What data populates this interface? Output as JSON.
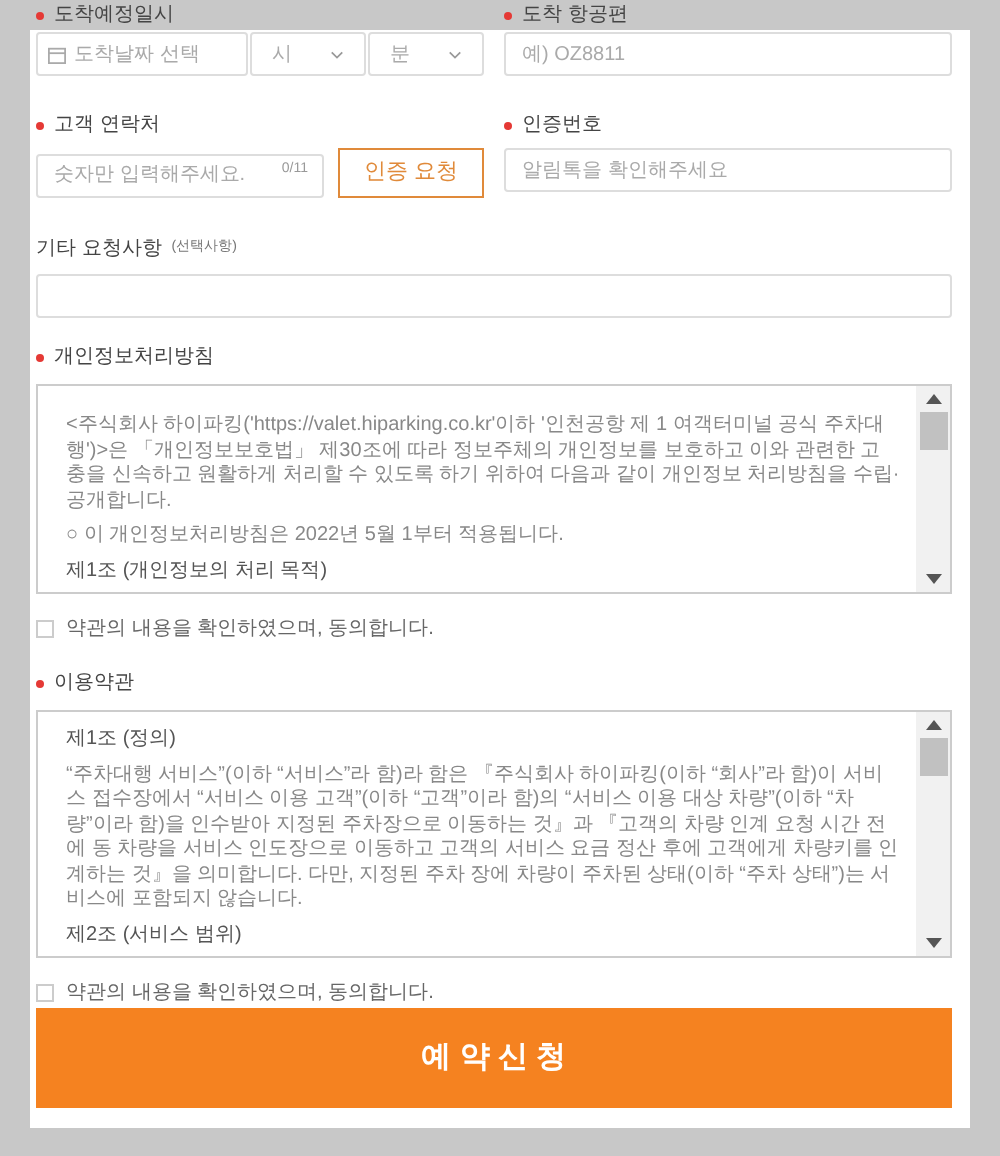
{
  "arrival": {
    "label": "도착예정일시",
    "required": true,
    "date_placeholder": "도착날짜 선택",
    "hour_placeholder": "시",
    "minute_placeholder": "분"
  },
  "flight": {
    "label": "도착 항공편",
    "required": true,
    "placeholder": "예) OZ8811"
  },
  "phone": {
    "label": "고객 연락처",
    "required": true,
    "placeholder": "숫자만 입력해주세요.",
    "counter": "0/11",
    "button": "인증 요청"
  },
  "auth_code": {
    "label": "인증번호",
    "required": true,
    "placeholder": "알림톡을 확인해주세요"
  },
  "request": {
    "label": "기타 요청사항",
    "note": "(선택사항)"
  },
  "privacy": {
    "label": "개인정보처리방침",
    "required": true,
    "blocks": [
      {
        "kind": "text",
        "text": "<주식회사 하이파킹('https://valet.hiparking.co.kr'이하 '인천공항 제 1 여객터미널 공식 주차대행')>은 「개인정보보호법」 제30조에 따라 정보주체의 개인정보를 보호하고 이와 관련한 고충을 신속하고 원활하게 처리할 수 있도록 하기 위하여 다음과 같이 개인정보 처리방침을 수립·공개합니다."
      },
      {
        "kind": "text",
        "text": "○ 이 개인정보처리방침은 2022년 5월 1부터 적용됩니다."
      },
      {
        "kind": "heading",
        "text": "제1조 (개인정보의 처리 목적)"
      }
    ],
    "agree": {
      "label": "약관의 내용을 확인하였으며, 동의합니다.",
      "checked": false
    }
  },
  "terms": {
    "label": "이용약관",
    "required": true,
    "blocks": [
      {
        "kind": "heading",
        "text": "제1조 (정의)"
      },
      {
        "kind": "text",
        "text": "“주차대행 서비스”(이하 “서비스”라 함)라 함은 『주식회사 하이파킹(이하 “회사”라 함)이 서비스 접수장에서 “서비스 이용 고객”(이하 “고객”이라 함)의 “서비스 이용 대상 차량”(이하 “차량”이라 함)을 인수받아 지정된 주차장으로 이동하는 것』과 『고객의 차량 인계 요청 시간 전에 동 차량을 서비스 인도장으로 이동하고 고객의 서비스 요금 정산 후에 고객에게 차량키를 인계하는 것』을 의미합니다. 다만, 지정된 주차 장에 차량이 주차된 상태(이하 “주차 상태”)는 서비스에 포함되지 않습니다."
      },
      {
        "kind": "heading",
        "text": "제2조 (서비스 범위)"
      }
    ],
    "agree": {
      "label": "약관의 내용을 확인하였으며, 동의합니다.",
      "checked": false
    }
  },
  "submit": "예 약 신 청"
}
